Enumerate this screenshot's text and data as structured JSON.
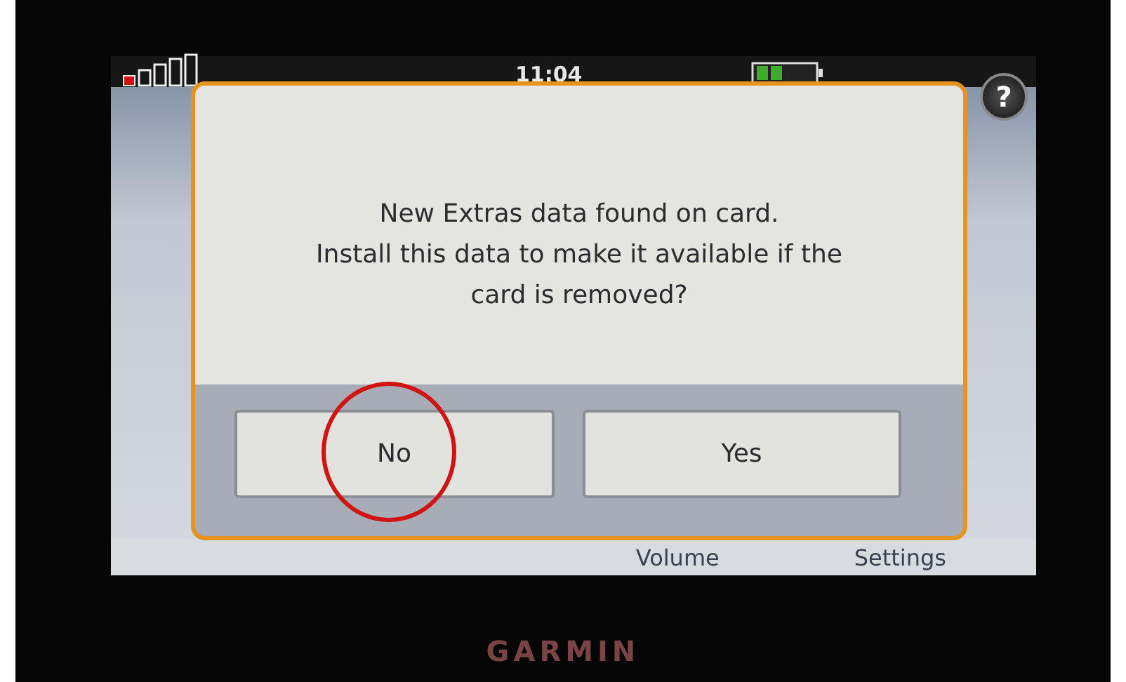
{
  "status_bar": {
    "time": "11:04"
  },
  "help_button": {
    "label": "?"
  },
  "dialog": {
    "message_lines": [
      "New Extras data found on card.",
      "Install this data to make it available if the",
      "card is removed?"
    ],
    "buttons": [
      {
        "label": "No",
        "circled": true
      },
      {
        "label": "Yes",
        "circled": false
      }
    ]
  },
  "bottom_bar": {
    "items": [
      "Volume",
      "Settings"
    ]
  },
  "bezel": {
    "brand": "GARMIN"
  }
}
